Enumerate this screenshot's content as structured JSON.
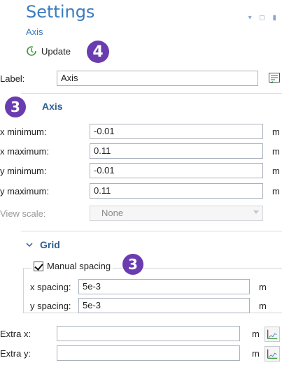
{
  "header": {
    "title": "Settings",
    "subtitle": "Axis",
    "update_label": "Update",
    "update_badge": "4"
  },
  "label_field": {
    "label": "Label:",
    "value": "Axis"
  },
  "axis_section": {
    "badge": "3",
    "title": "Axis",
    "rows": [
      {
        "label": "x minimum:",
        "value": "-0.01",
        "unit": "m"
      },
      {
        "label": "x maximum:",
        "value": "0.11",
        "unit": "m"
      },
      {
        "label": "y minimum:",
        "value": "-0.01",
        "unit": "m"
      },
      {
        "label": "y maximum:",
        "value": "0.11",
        "unit": "m"
      }
    ],
    "view_scale": {
      "label": "View scale:",
      "value": "None"
    }
  },
  "grid_section": {
    "title": "Grid",
    "manual_spacing_label": "Manual spacing",
    "manual_spacing_checked": true,
    "badge": "3",
    "spacing_rows": [
      {
        "label": "x spacing:",
        "value": "5e-3",
        "unit": "m"
      },
      {
        "label": "y spacing:",
        "value": "5e-3",
        "unit": "m"
      }
    ],
    "extra_rows": [
      {
        "label": "Extra x:",
        "value": "",
        "unit": "m"
      },
      {
        "label": "Extra y:",
        "value": "",
        "unit": "m"
      }
    ]
  },
  "colors": {
    "title_blue": "#3a7bbf",
    "section_blue": "#2e5f95",
    "badge_purple": "#6a3cb0"
  },
  "icons": {
    "update": "refresh-icon",
    "label_button": "text-insert-icon",
    "extra_button": "range-chart-icon",
    "section_toggle": "chevron-down-icon"
  }
}
